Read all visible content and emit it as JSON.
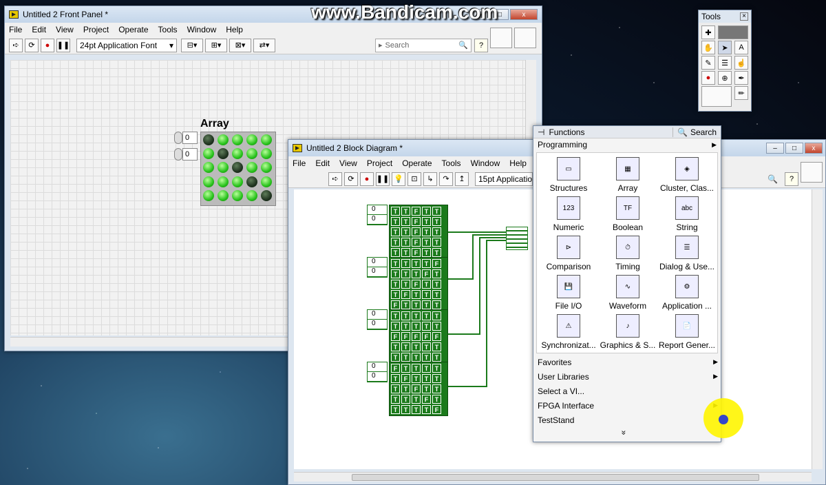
{
  "watermark": "www.Bandicam.com",
  "front_panel": {
    "title": "Untitled 2 Front Panel *",
    "menu": [
      "File",
      "Edit",
      "View",
      "Project",
      "Operate",
      "Tools",
      "Window",
      "Help"
    ],
    "font": "24pt Application Font",
    "search_placeholder": "Search",
    "array_label": "Array",
    "index_values": [
      "0",
      "0"
    ],
    "leds": [
      [
        0,
        1,
        1,
        1,
        1
      ],
      [
        1,
        0,
        1,
        1,
        1
      ],
      [
        1,
        1,
        0,
        1,
        1
      ],
      [
        1,
        1,
        1,
        0,
        1
      ],
      [
        1,
        1,
        1,
        1,
        0
      ]
    ]
  },
  "tools": {
    "title": "Tools",
    "close": "×"
  },
  "block_diagram": {
    "title": "Untitled 2 Block Diagram *",
    "menu": [
      "File",
      "Edit",
      "View",
      "Project",
      "Operate",
      "Tools",
      "Window",
      "Help"
    ],
    "font": "15pt Applicatio",
    "constants": [
      {
        "idx": [
          "0",
          "0"
        ],
        "rows": [
          "TTFTT",
          "TTFTT",
          "TTFTT",
          "TTFTT",
          "TTFTT"
        ]
      },
      {
        "idx": [
          "0",
          "0"
        ],
        "rows": [
          "TTTTF",
          "TTTFT",
          "TTFTT",
          "TFTTT",
          "FTTTT"
        ]
      },
      {
        "idx": [
          "0",
          "0"
        ],
        "rows": [
          "TTTTT",
          "TTTTT",
          "FFFFF",
          "TTTTT",
          "TTTTT"
        ]
      },
      {
        "idx": [
          "0",
          "0"
        ],
        "rows": [
          "FTTTT",
          "TFTTT",
          "TTFTT",
          "TTTFT",
          "TTTTF"
        ]
      }
    ]
  },
  "functions": {
    "title": "Functions",
    "search": "Search",
    "category": "Programming",
    "items": [
      "Structures",
      "Array",
      "Cluster, Clas...",
      "Numeric",
      "Boolean",
      "String",
      "Comparison",
      "Timing",
      "Dialog & Use...",
      "File I/O",
      "Waveform",
      "Application ...",
      "Synchronizat...",
      "Graphics & S...",
      "Report Gener..."
    ],
    "menu": [
      "Favorites",
      "User Libraries",
      "Select a VI...",
      "FPGA Interface",
      "TestStand"
    ],
    "more": "»"
  },
  "window_buttons": {
    "min": "–",
    "max": "□",
    "close": "x"
  }
}
